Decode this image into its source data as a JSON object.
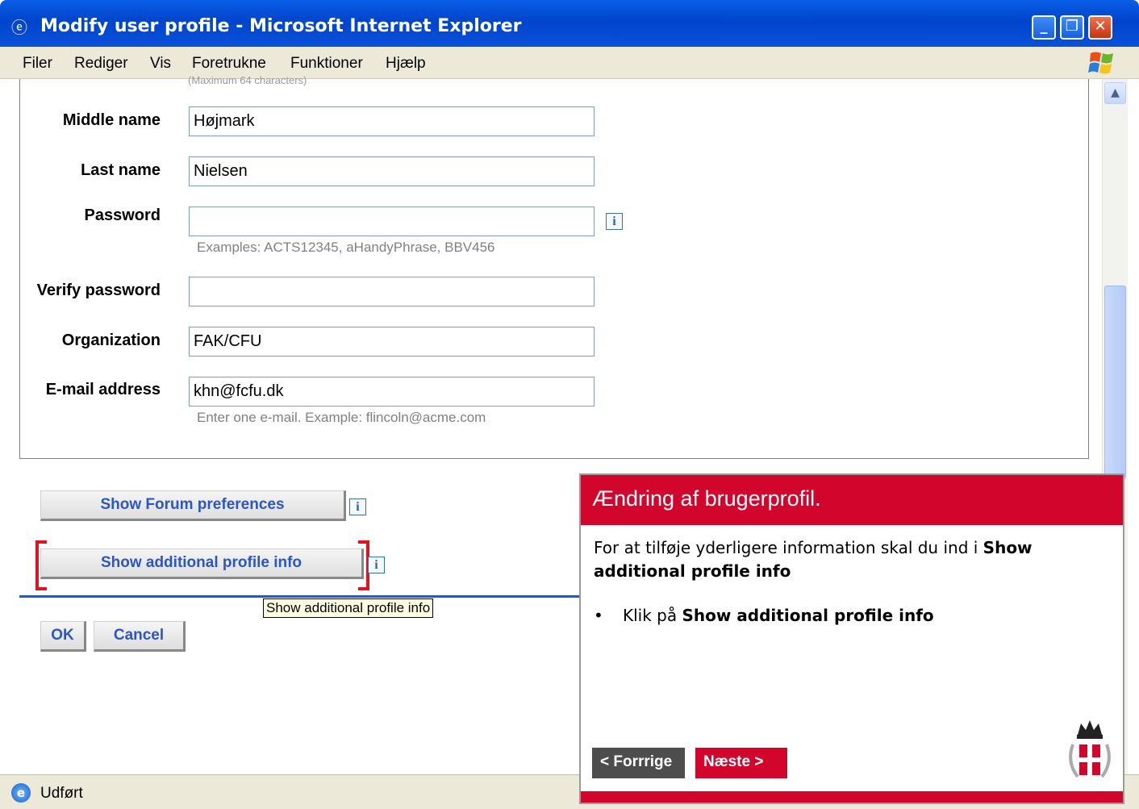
{
  "window": {
    "title": "Modify user profile - Microsoft Internet Explorer",
    "minimize_label": "_",
    "restore_label": "❐",
    "close_label": "✕"
  },
  "menu": [
    "Filer",
    "Rediger",
    "Vis",
    "Foretrukne",
    "Funktioner",
    "Hjælp"
  ],
  "form": {
    "cut_text": "(Maximum 64 characters)",
    "middle_name": {
      "label": "Middle name",
      "value": "Højmark"
    },
    "last_name": {
      "label": "Last name",
      "value": "Nielsen"
    },
    "password": {
      "label": "Password",
      "value": "",
      "hint": "Examples: ACTS12345, aHandyPhrase, BBV456"
    },
    "verify_password": {
      "label": "Verify password",
      "value": ""
    },
    "organization": {
      "label": "Organization",
      "value": "FAK/CFU"
    },
    "email": {
      "label": "E-mail address",
      "value": "khn@fcfu.dk",
      "hint": "Enter one e-mail. Example: flincoln@acme.com"
    },
    "info_glyph": "i"
  },
  "buttons": {
    "forum_prefs": "Show Forum preferences",
    "additional_info": "Show additional profile info",
    "ok": "OK",
    "cancel": "Cancel"
  },
  "tooltip": "Show additional profile info",
  "status": {
    "text": "Udført",
    "icon": "e"
  },
  "guide": {
    "title": "Ændring af brugerprofil.",
    "para_prefix": "For at tilføje yderligere information skal du ind i ",
    "para_bold": "Show additional profile info",
    "bullet_prefix": "Klik på ",
    "bullet_bold": "Show additional profile info",
    "prev": "< Forrrige",
    "next": "Næste >"
  },
  "colors": {
    "brand_red": "#d2062d",
    "link_blue": "#2b56c4",
    "xp_blue": "#0044cc"
  }
}
